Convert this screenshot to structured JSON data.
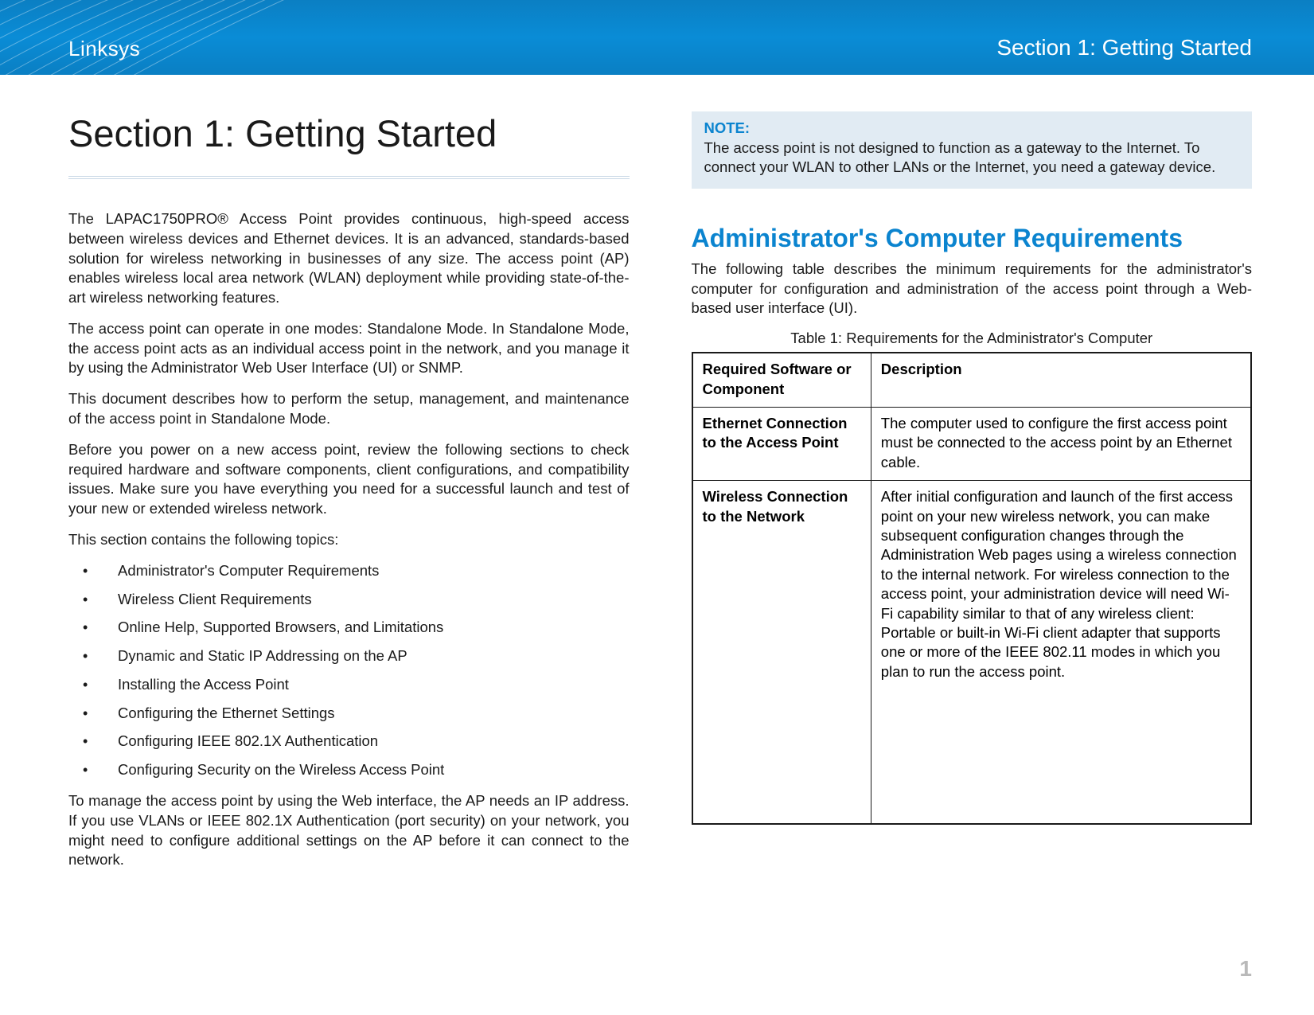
{
  "header": {
    "brand": "Linksys",
    "section_label": "Section 1:  Getting Started"
  },
  "left": {
    "title": "Section 1:  Getting Started",
    "p1": "The LAPAC1750PRO® Access Point provides continuous, high-speed access between wireless devices and Ethernet devices. It is an advanced, standards-based solution for wireless networking in businesses of any size. The access point (AP) enables wireless local area network (WLAN) deployment while providing state-of-the-art wireless networking features.",
    "p2": "The access point can operate in one modes: Standalone Mode. In Standalone Mode, the access point acts as an individual access point in the network, and you manage it by using the Administrator Web User Interface (UI) or SNMP.",
    "p3": "This document describes how to perform the setup, management, and maintenance of the access point in Standalone Mode.",
    "p4": "Before you power on a new access point, review the following sections to check required hardware and software components, client configurations, and compatibility issues. Make sure you have everything you need for a successful launch and test of your new or extended wireless network.",
    "p5": "This section contains the following topics:",
    "topics": [
      "Administrator's Computer Requirements",
      "Wireless Client Requirements",
      "Online Help, Supported Browsers, and Limitations",
      "Dynamic and Static IP Addressing on the AP",
      "Installing the Access Point",
      "Configuring the Ethernet Settings",
      "Configuring IEEE 802.1X Authentication",
      "Configuring Security on the Wireless Access Point"
    ],
    "p6": "To manage the access point by using the Web interface, the AP needs an IP address. If you use VLANs or IEEE 802.1X Authentication (port security) on your network, you might need to configure additional settings on the AP before it can connect to the network."
  },
  "right": {
    "note_title": "NOTE:",
    "note_body": "The access point is not designed to function as a gateway to the Internet. To connect your WLAN to other LANs or the Internet, you need a gateway device.",
    "subhead": "Administrator's Computer Requirements",
    "intro": "The following table describes the minimum requirements for the administrator's computer for configuration and administration of the access point through a Web-based user interface (UI).",
    "table_caption": "Table 1: Requirements for the Administrator's Computer",
    "table": {
      "col1": "Required Software or Component",
      "col2": "Description",
      "rows": [
        {
          "c1": "Ethernet Connection to the Access Point",
          "c2": "The computer used to configure the first access point must be connected to the access point by an Ethernet cable."
        },
        {
          "c1": "Wireless Connection to the Network",
          "c2": "After initial configuration and launch of the first access point on your new wireless network, you can make subsequent configuration changes through the Administration Web pages using a wireless connection to the internal network. For wireless connection to the access point, your administration device will need Wi-Fi capability similar to that of any wireless client:  Portable or built-in Wi-Fi client adapter that supports one or more of the IEEE 802.11 modes in which you plan to run the access point."
        }
      ]
    }
  },
  "page_number": "1"
}
